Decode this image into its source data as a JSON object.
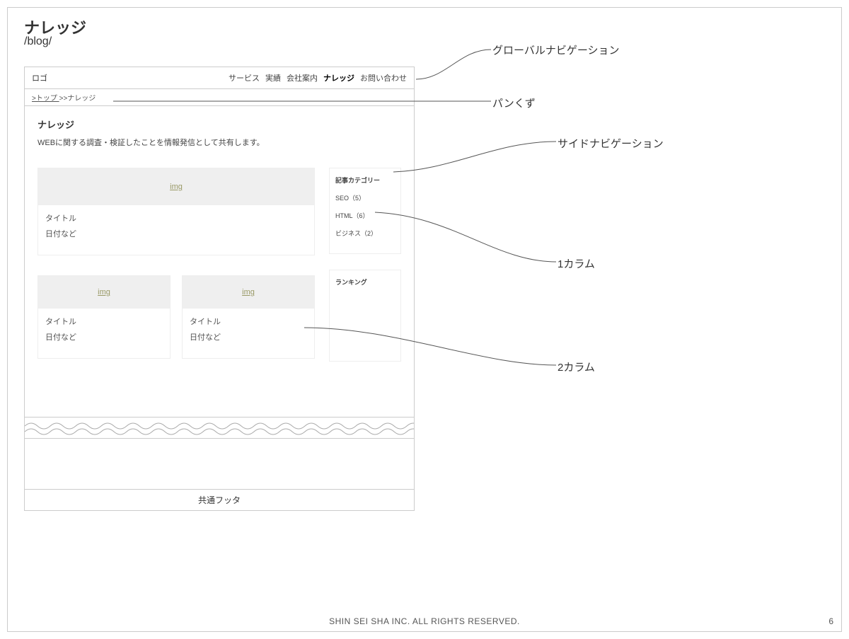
{
  "page": {
    "title": "ナレッジ",
    "path": "/blog/",
    "footer_copyright": "SHIN SEI SHA INC. ALL RIGHTS RESERVED.",
    "page_number": "6"
  },
  "mock": {
    "logo": "ロゴ",
    "nav": {
      "items": [
        "サービス",
        "実績",
        "会社案内",
        "ナレッジ",
        "お問い合わせ"
      ],
      "active_index": 3
    },
    "breadcrumb": {
      "top_link": ">トップ ",
      "current": ">>ナレッジ"
    },
    "content": {
      "title": "ナレッジ",
      "desc": "WEBに関する調査・検証したことを情報発信として共有します。"
    },
    "card_img_label": "img",
    "card_meta_title": "タイトル",
    "card_meta_date": "日付など",
    "sidebar": {
      "category_heading": "記事カテゴリー",
      "categories": [
        "SEO（5）",
        "HTML（6）",
        "ビジネス（2）"
      ],
      "ranking_heading": "ランキング"
    },
    "footer_label": "共通フッタ"
  },
  "annotations": {
    "global_nav": "グローバルナビゲーション",
    "breadcrumb": "パンくず",
    "side_nav": "サイドナビゲーション",
    "col1": "1カラム",
    "col2": "2カラム"
  }
}
